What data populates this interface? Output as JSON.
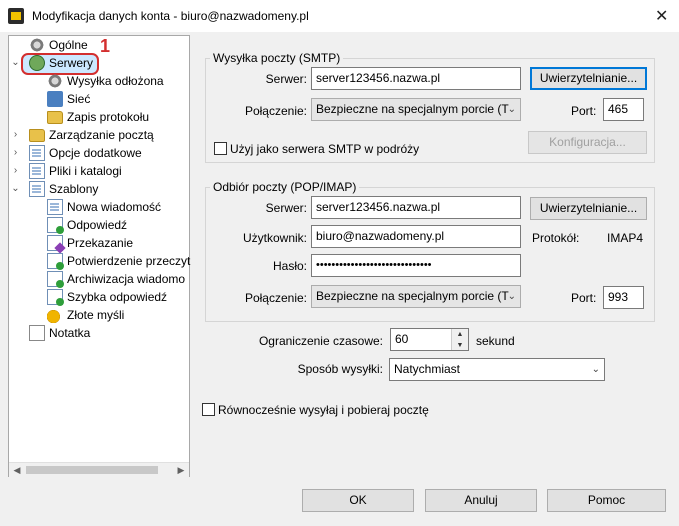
{
  "window": {
    "title": "Modyfikacja danych konta - biuro@nazwadomeny.pl",
    "close_glyph": "✕"
  },
  "annotation": {
    "badge": "1"
  },
  "tree": {
    "items": [
      {
        "label": "Ogólne",
        "icon": "gear-icon"
      },
      {
        "label": "Serwery",
        "icon": "server-icon",
        "selected": true
      },
      {
        "label": "Wysyłka odłożona",
        "icon": "gear-icon"
      },
      {
        "label": "Sieć",
        "icon": "network-icon"
      },
      {
        "label": "Zapis protokołu",
        "icon": "folder-icon"
      },
      {
        "label": "Zarządzanie pocztą",
        "icon": "folder-icon"
      },
      {
        "label": "Opcje dodatkowe",
        "icon": "document-icon"
      },
      {
        "label": "Pliki i katalogi",
        "icon": "document-icon"
      },
      {
        "label": "Szablony",
        "icon": "document-icon"
      },
      {
        "label": "Nowa wiadomość",
        "icon": "document-icon"
      },
      {
        "label": "Odpowiedź",
        "icon": "reply-icon"
      },
      {
        "label": "Przekazanie",
        "icon": "forward-icon"
      },
      {
        "label": "Potwierdzenie przeczyt",
        "icon": "confirm-icon"
      },
      {
        "label": "Archiwizacja wiadomo",
        "icon": "archive-icon"
      },
      {
        "label": "Szybka odpowiedź",
        "icon": "quick-reply-icon"
      },
      {
        "label": "Złote myśli",
        "icon": "coins-icon"
      },
      {
        "label": "Notatka",
        "icon": "note-icon"
      }
    ]
  },
  "smtp": {
    "group_title": "Wysyłka poczty (SMTP)",
    "server_label": "Serwer:",
    "server_value": "server123456.nazwa.pl",
    "auth_button": "Uwierzytelnianie...",
    "connection_label": "Połączenie:",
    "connection_value": "Bezpieczne na specjalnym porcie (T",
    "port_label": "Port:",
    "port_value": "465",
    "travel_checkbox": "Użyj jako serwera SMTP w podróży",
    "config_button": "Konfiguracja..."
  },
  "pop": {
    "group_title": "Odbiór poczty (POP/IMAP)",
    "server_label": "Serwer:",
    "server_value": "server123456.nazwa.pl",
    "auth_button": "Uwierzytelnianie...",
    "user_label": "Użytkownik:",
    "user_value": "biuro@nazwadomeny.pl",
    "protocol_label": "Protokół:",
    "protocol_value": "IMAP4",
    "password_label": "Hasło:",
    "password_value": "••••••••••••••••••••••••••••••",
    "connection_label": "Połączenie:",
    "connection_value": "Bezpieczne na specjalnym porcie (T",
    "port_label": "Port:",
    "port_value": "993"
  },
  "timeout": {
    "label": "Ograniczenie czasowe:",
    "value": "60",
    "unit": "sekund"
  },
  "send_mode": {
    "label": "Sposób wysyłki:",
    "value": "Natychmiast"
  },
  "simultaneous_checkbox": "Równocześnie wysyłaj i pobieraj pocztę",
  "buttons": {
    "ok": "OK",
    "cancel": "Anuluj",
    "help": "Pomoc"
  }
}
